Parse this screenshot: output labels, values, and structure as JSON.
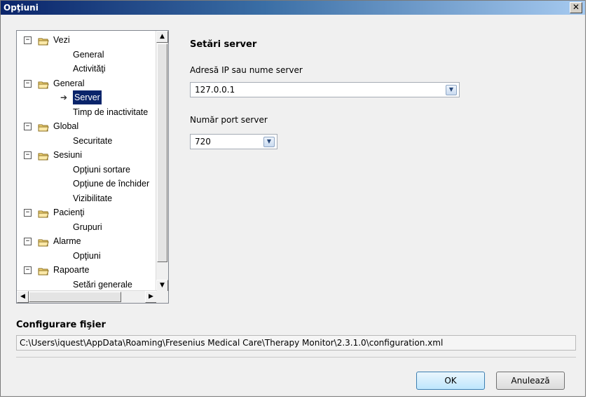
{
  "window": {
    "title": "Opţiuni",
    "close_glyph": "✕"
  },
  "tree": {
    "items": [
      {
        "kind": "parent",
        "label": "Vezi",
        "expander": "−"
      },
      {
        "kind": "child",
        "label": "General"
      },
      {
        "kind": "child",
        "label": "Activităţi"
      },
      {
        "kind": "parent",
        "label": "General",
        "expander": "−"
      },
      {
        "kind": "child",
        "label": "Server",
        "selected": true
      },
      {
        "kind": "child",
        "label": "Timp de inactivitate"
      },
      {
        "kind": "parent",
        "label": "Global",
        "expander": "−"
      },
      {
        "kind": "child",
        "label": "Securitate"
      },
      {
        "kind": "parent",
        "label": "Sesiuni",
        "expander": "−"
      },
      {
        "kind": "child",
        "label": "Opţiuni sortare"
      },
      {
        "kind": "child",
        "label": "Opţiune de închider"
      },
      {
        "kind": "child",
        "label": "Vizibilitate"
      },
      {
        "kind": "parent",
        "label": "Pacienţi",
        "expander": "−"
      },
      {
        "kind": "child",
        "label": "Grupuri"
      },
      {
        "kind": "parent",
        "label": "Alarme",
        "expander": "−"
      },
      {
        "kind": "child",
        "label": "Opţiuni"
      },
      {
        "kind": "parent",
        "label": "Rapoarte",
        "expander": "−"
      },
      {
        "kind": "child",
        "label": "Setări generale"
      }
    ]
  },
  "server": {
    "section_title": "Setări server",
    "ip_label": "Adresă IP sau nume server",
    "ip_value": "127.0.0.1",
    "port_label": "Număr port server",
    "port_value": "720"
  },
  "config": {
    "title": "Configurare fişier",
    "path": "C:\\Users\\iquest\\AppData\\Roaming\\Fresenius Medical Care\\Therapy Monitor\\2.3.1.0\\configuration.xml"
  },
  "buttons": {
    "ok": "OK",
    "cancel": "Anulează"
  },
  "colors": {
    "titlebar_start": "#0a246a",
    "selection": "#0a246a"
  }
}
